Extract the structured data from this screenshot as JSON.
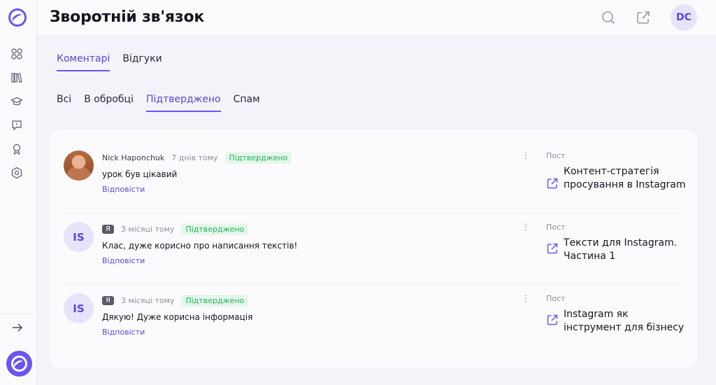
{
  "header": {
    "title": "Зворотній зв'язок",
    "avatar_initials": "DC"
  },
  "tabs": [
    {
      "label": "Коментарі",
      "active": true
    },
    {
      "label": "Відгуки",
      "active": false
    }
  ],
  "filters": [
    {
      "label": "Всі",
      "active": false
    },
    {
      "label": "В обробці",
      "active": false
    },
    {
      "label": "Підтверджено",
      "active": true
    },
    {
      "label": "Спам",
      "active": false
    }
  ],
  "comments": [
    {
      "author": "Nick Haponchuk",
      "author_badge": "",
      "avatar_initials": "",
      "time": "7 днів тому",
      "status": "Підтверджено",
      "text": "урок був цікавий",
      "reply": "Відповісти",
      "post_label": "Пост",
      "post_title": "Контент-стратегія просування в Instagram"
    },
    {
      "author": "",
      "author_badge": "Я",
      "avatar_initials": "IS",
      "time": "3 місяці тому",
      "status": "Підтверджено",
      "text": "Клас, дуже корисно про написання текстів!",
      "reply": "Відповісти",
      "post_label": "Пост",
      "post_title": "Тексти для Instagram. Частина 1"
    },
    {
      "author": "",
      "author_badge": "Я",
      "avatar_initials": "IS",
      "time": "3 місяці тому",
      "status": "Підтверджено",
      "text": "Дякую! Дуже корисна інформація",
      "reply": "Відповісти",
      "post_label": "Пост",
      "post_title": "Instagram як інструмент для бізнесу"
    }
  ],
  "colors": {
    "accent": "#6b55f0",
    "status_green": "#1fb35a",
    "background": "#f4f3fa"
  },
  "icons": {
    "sidebar": [
      "dashboard-icon",
      "library-icon",
      "graduation-cap-icon",
      "feedback-icon",
      "award-icon",
      "settings-hexagon-icon"
    ],
    "header": [
      "search-icon",
      "external-link-icon"
    ]
  }
}
